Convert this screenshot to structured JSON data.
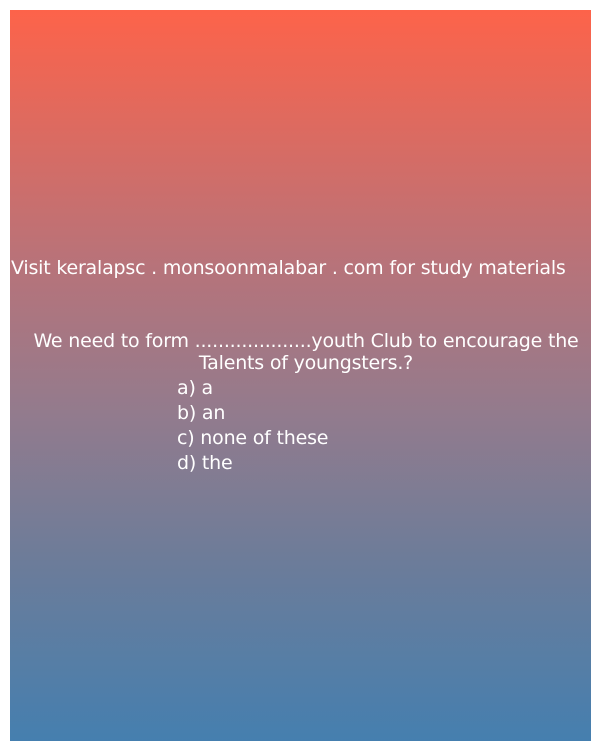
{
  "promo": {
    "text": "Visit keralapsc . monsoonmalabar . com for study materials"
  },
  "question": {
    "text": "We need to form ....................youth Club to encourage the Talents of youngsters.?"
  },
  "options": [
    {
      "label": "a) a"
    },
    {
      "label": "b) an"
    },
    {
      "label": "c) none of these"
    },
    {
      "label": "d) the"
    }
  ],
  "colors": {
    "gradient_top": "#fd634a",
    "gradient_bottom": "#457faf",
    "text": "#ffffff"
  }
}
